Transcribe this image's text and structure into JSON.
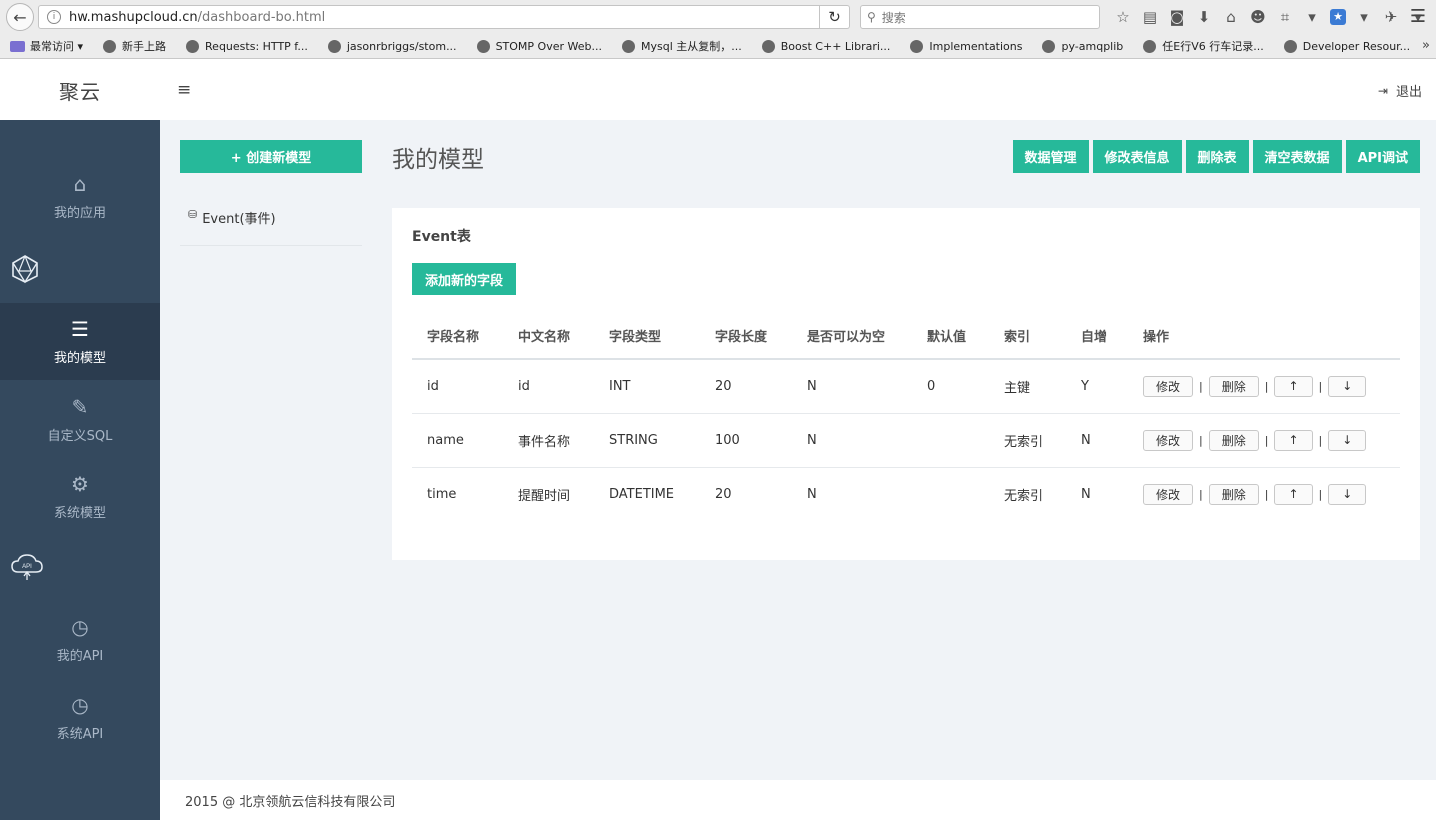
{
  "browser": {
    "url_host": "hw.mashupcloud.cn",
    "url_path": "/dashboard-bo.html",
    "search_placeholder": "搜索",
    "info_glyph": "i",
    "reload_glyph": "↻",
    "back_glyph": "←",
    "menu_glyph": "☰",
    "bookmarks": [
      "最常访问",
      "新手上路",
      "Requests: HTTP f...",
      "jasonrbriggs/stom...",
      "STOMP Over Web...",
      "Mysql 主从复制，...",
      "Boost C++ Librari...",
      "Implementations",
      "py-amqplib",
      "任E行V6 行车记录...",
      "Developer Resour..."
    ],
    "overflow": "»"
  },
  "header": {
    "logo": "聚云",
    "hamburger": "≡",
    "logout": "退出"
  },
  "sidebar": {
    "items": [
      {
        "label": "我的应用",
        "icon": "home-icon",
        "glyph": "⌂"
      },
      {
        "label": "我的模型",
        "icon": "list-icon",
        "glyph": "☰"
      },
      {
        "label": "自定义SQL",
        "icon": "edit-icon",
        "glyph": "✎"
      },
      {
        "label": "系统模型",
        "icon": "gear-icon",
        "glyph": "⚙"
      },
      {
        "label": "我的API",
        "icon": "clock-icon",
        "glyph": "◷"
      },
      {
        "label": "系统API",
        "icon": "clock-icon",
        "glyph": "◷"
      }
    ],
    "api_cloud_text": "API"
  },
  "main": {
    "create_button": "+ 创建新模型",
    "model_list": [
      {
        "label": "Event(事件)"
      }
    ],
    "page_title": "我的模型",
    "actions": [
      "数据管理",
      "修改表信息",
      "删除表",
      "清空表数据",
      "API调试"
    ],
    "panel_title": "Event表",
    "add_field_button": "添加新的字段",
    "table": {
      "headers": [
        "字段名称",
        "中文名称",
        "字段类型",
        "字段长度",
        "是否可以为空",
        "默认值",
        "索引",
        "自增",
        "操作"
      ],
      "rows": [
        [
          "id",
          "id",
          "INT",
          "20",
          "N",
          "0",
          "主键",
          "Y"
        ],
        [
          "name",
          "事件名称",
          "STRING",
          "100",
          "N",
          "",
          "无索引",
          "N"
        ],
        [
          "time",
          "提醒时间",
          "DATETIME",
          "20",
          "N",
          "",
          "无索引",
          "N"
        ]
      ],
      "op_labels": {
        "edit": "修改",
        "delete": "删除",
        "up": "↑",
        "down": "↓",
        "sep": "|"
      }
    }
  },
  "footer": "2015 @ 北京领航云信科技有限公司",
  "colors": {
    "accent": "#26b99a",
    "sidebar": "#34495e",
    "sidebar_active": "#2b3c4f",
    "background": "#f0f3f7"
  }
}
